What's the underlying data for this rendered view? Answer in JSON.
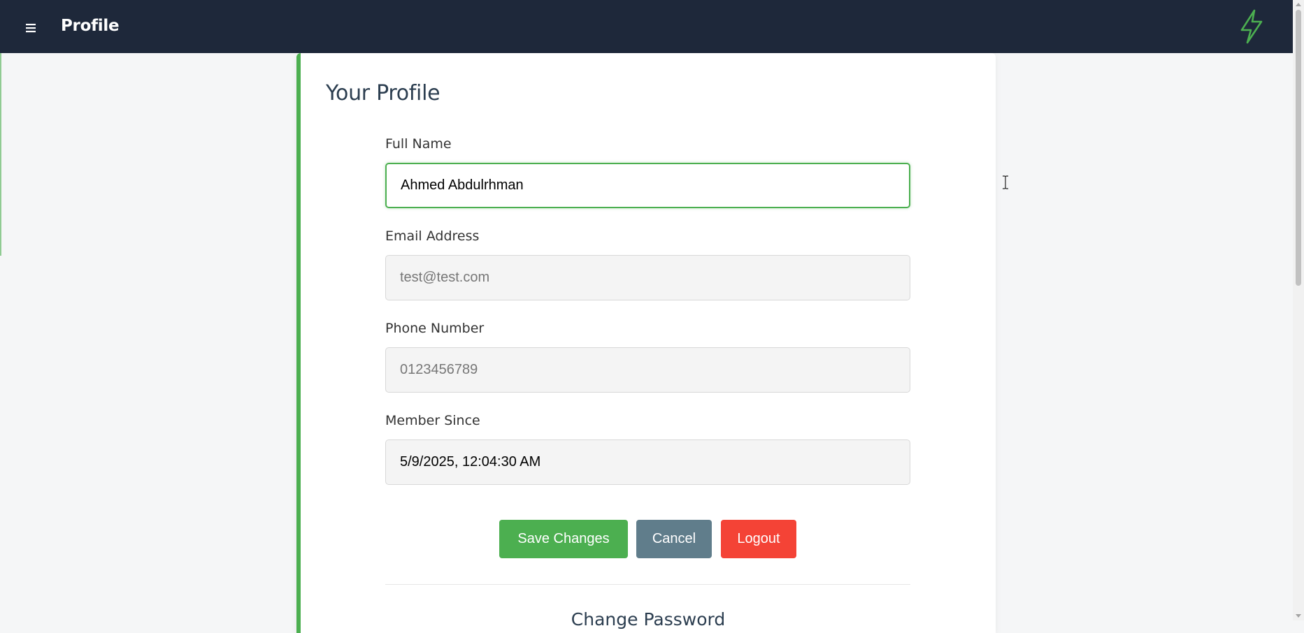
{
  "header": {
    "menu_icon": "hamburger-menu-icon",
    "title": "Profile",
    "logo_icon": "lightning-bolt-icon",
    "logo_color": "#4caf50",
    "background": "#1e283a"
  },
  "profile": {
    "title": "Your Profile",
    "accent_color": "#4caf50",
    "fields": {
      "full_name": {
        "label": "Full Name",
        "value": "Ahmed Abdulrhman"
      },
      "email": {
        "label": "Email Address",
        "value": "test@test.com"
      },
      "phone": {
        "label": "Phone Number",
        "value": "0123456789"
      },
      "member_since": {
        "label": "Member Since",
        "value": "5/9/2025, 12:04:30 AM"
      }
    },
    "buttons": {
      "save": "Save Changes",
      "cancel": "Cancel",
      "logout": "Logout"
    },
    "button_colors": {
      "save": "#4caf50",
      "cancel": "#607d8b",
      "logout": "#f44336"
    }
  },
  "change_password": {
    "title": "Change Password"
  }
}
